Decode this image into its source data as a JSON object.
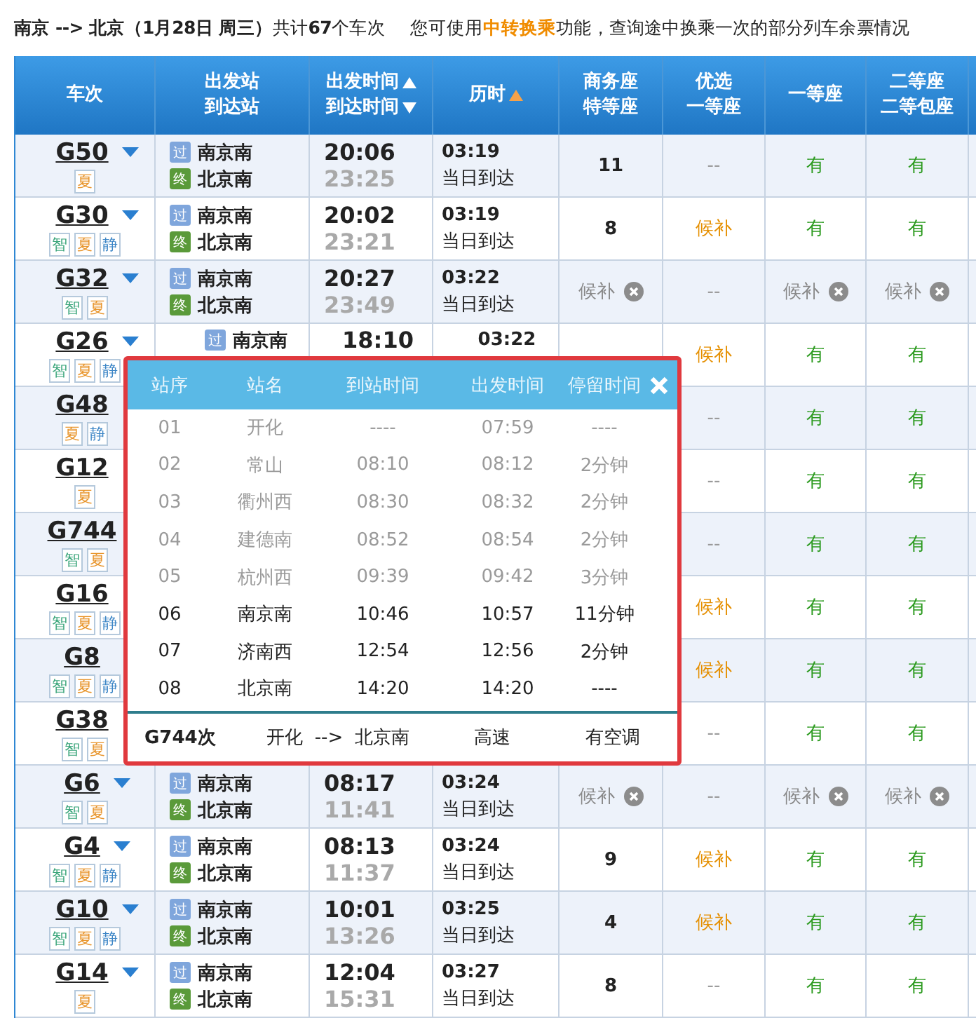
{
  "summary": "**南京 --> 北京（1月28日  周三）**共计**67**个车次",
  "notice": {
    "before": "您可使用",
    "link": "中转换乘",
    "after": "功能，查询途中换乘一次的部分列车余票情况"
  },
  "columns": [
    {
      "lines": [
        {
          "text": "车次"
        }
      ]
    },
    {
      "lines": [
        {
          "text": "出发站"
        },
        {
          "text": "到达站"
        }
      ]
    },
    {
      "lines": [
        {
          "text": "出发时间",
          "kind": "sort_up",
          "active": false
        },
        {
          "text": "到达时间",
          "kind": "sort_down",
          "active": false
        }
      ]
    },
    {
      "lines": [
        {
          "text": "历时",
          "kind": "sort_up",
          "active": true
        }
      ]
    },
    {
      "lines": [
        {
          "text": "商务座"
        },
        {
          "text": "特等座"
        }
      ]
    },
    {
      "lines": [
        {
          "text": "优选"
        },
        {
          "text": "一等座"
        }
      ]
    },
    {
      "lines": [
        {
          "text": "一等座"
        }
      ]
    },
    {
      "lines": [
        {
          "text": "二等座"
        },
        {
          "text": "二等包座"
        }
      ]
    }
  ],
  "trains": [
    {
      "code": "G50",
      "tags": [
        {
          "label": "夏",
          "color": "#e8952c"
        }
      ],
      "from": {
        "badge": "过",
        "name": "南京南"
      },
      "to": {
        "badge": "终",
        "name": "北京南"
      },
      "depart": "20:06",
      "arrive": "23:25",
      "duration": "03:19",
      "arrival_day": "当日到达",
      "business": {
        "kind": "count",
        "text": "11"
      },
      "premium_first": {
        "kind": "none",
        "text": "--"
      },
      "first": {
        "kind": "available",
        "text": "有"
      },
      "second": {
        "kind": "available",
        "text": "有"
      }
    },
    {
      "code": "G30",
      "tags": [
        {
          "label": "智",
          "color": "#3aa57a"
        },
        {
          "label": "夏",
          "color": "#e8952c"
        },
        {
          "label": "静",
          "color": "#3d86c6"
        }
      ],
      "from": {
        "badge": "过",
        "name": "南京南"
      },
      "to": {
        "badge": "终",
        "name": "北京南"
      },
      "depart": "20:02",
      "arrive": "23:21",
      "duration": "03:19",
      "arrival_day": "当日到达",
      "business": {
        "kind": "count",
        "text": "8"
      },
      "premium_first": {
        "kind": "waitlist",
        "text": "候补"
      },
      "first": {
        "kind": "available",
        "text": "有"
      },
      "second": {
        "kind": "available",
        "text": "有"
      }
    },
    {
      "code": "G32",
      "tags": [
        {
          "label": "智",
          "color": "#3aa57a"
        },
        {
          "label": "夏",
          "color": "#e8952c"
        }
      ],
      "from": {
        "badge": "过",
        "name": "南京南"
      },
      "to": {
        "badge": "终",
        "name": "北京南"
      },
      "depart": "20:27",
      "arrive": "23:49",
      "duration": "03:22",
      "arrival_day": "当日到达",
      "business": {
        "kind": "waitlist_closed",
        "text": "候补"
      },
      "premium_first": {
        "kind": "none",
        "text": "--"
      },
      "first": {
        "kind": "waitlist_closed",
        "text": "候补"
      },
      "second": {
        "kind": "waitlist_closed",
        "text": "候补"
      }
    },
    {
      "code": "G26",
      "tags": [
        {
          "label": "智",
          "color": "#3aa57a"
        },
        {
          "label": "夏",
          "color": "#e8952c"
        },
        {
          "label": "静",
          "color": "#3d86c6"
        }
      ],
      "from": {
        "badge": "过",
        "name": "南京南"
      },
      "depart": "18:10",
      "duration": "03:22",
      "premium_first": {
        "kind": "waitlist",
        "text": "候补"
      },
      "first": {
        "kind": "available",
        "text": "有"
      },
      "second": {
        "kind": "available",
        "text": "有"
      }
    },
    {
      "code": "G48",
      "tags": [
        {
          "label": "夏",
          "color": "#e8952c"
        },
        {
          "label": "静",
          "color": "#3d86c6"
        }
      ],
      "premium_first": {
        "kind": "none",
        "text": "--"
      },
      "first": {
        "kind": "available",
        "text": "有"
      },
      "second": {
        "kind": "available",
        "text": "有"
      }
    },
    {
      "code": "G12",
      "tags": [
        {
          "label": "夏",
          "color": "#e8952c"
        }
      ],
      "premium_first": {
        "kind": "none",
        "text": "--"
      },
      "first": {
        "kind": "available",
        "text": "有"
      },
      "second": {
        "kind": "available",
        "text": "有"
      }
    },
    {
      "code": "G744",
      "tags": [
        {
          "label": "智",
          "color": "#3aa57a"
        },
        {
          "label": "夏",
          "color": "#e8952c"
        }
      ],
      "premium_first": {
        "kind": "none",
        "text": "--"
      },
      "first": {
        "kind": "available",
        "text": "有"
      },
      "second": {
        "kind": "available",
        "text": "有"
      }
    },
    {
      "code": "G16",
      "tags": [
        {
          "label": "智",
          "color": "#3aa57a"
        },
        {
          "label": "夏",
          "color": "#e8952c"
        },
        {
          "label": "静",
          "color": "#3d86c6"
        }
      ],
      "premium_first": {
        "kind": "waitlist",
        "text": "候补"
      },
      "first": {
        "kind": "available",
        "text": "有"
      },
      "second": {
        "kind": "available",
        "text": "有"
      }
    },
    {
      "code": "G8",
      "tags": [
        {
          "label": "智",
          "color": "#3aa57a"
        },
        {
          "label": "夏",
          "color": "#e8952c"
        },
        {
          "label": "静",
          "color": "#3d86c6"
        }
      ],
      "premium_first": {
        "kind": "waitlist",
        "text": "候补"
      },
      "first": {
        "kind": "available",
        "text": "有"
      },
      "second": {
        "kind": "available",
        "text": "有"
      }
    },
    {
      "code": "G38",
      "tags": [
        {
          "label": "智",
          "color": "#3aa57a"
        },
        {
          "label": "夏",
          "color": "#e8952c"
        }
      ],
      "premium_first": {
        "kind": "none",
        "text": "--"
      },
      "first": {
        "kind": "available",
        "text": "有"
      },
      "second": {
        "kind": "available",
        "text": "有"
      }
    },
    {
      "code": "G6",
      "tags": [
        {
          "label": "智",
          "color": "#3aa57a"
        },
        {
          "label": "夏",
          "color": "#e8952c"
        }
      ],
      "from": {
        "badge": "过",
        "name": "南京南"
      },
      "to": {
        "badge": "终",
        "name": "北京南"
      },
      "depart": "08:17",
      "arrive": "11:41",
      "duration": "03:24",
      "arrival_day": "当日到达",
      "business": {
        "kind": "waitlist_closed",
        "text": "候补"
      },
      "premium_first": {
        "kind": "none",
        "text": "--"
      },
      "first": {
        "kind": "waitlist_closed",
        "text": "候补"
      },
      "second": {
        "kind": "waitlist_closed",
        "text": "候补"
      }
    },
    {
      "code": "G4",
      "tags": [
        {
          "label": "智",
          "color": "#3aa57a"
        },
        {
          "label": "夏",
          "color": "#e8952c"
        },
        {
          "label": "静",
          "color": "#3d86c6"
        }
      ],
      "from": {
        "badge": "过",
        "name": "南京南"
      },
      "to": {
        "badge": "终",
        "name": "北京南"
      },
      "depart": "08:13",
      "arrive": "11:37",
      "duration": "03:24",
      "arrival_day": "当日到达",
      "business": {
        "kind": "count",
        "text": "9"
      },
      "premium_first": {
        "kind": "waitlist",
        "text": "候补"
      },
      "first": {
        "kind": "available",
        "text": "有"
      },
      "second": {
        "kind": "available",
        "text": "有"
      }
    },
    {
      "code": "G10",
      "tags": [
        {
          "label": "智",
          "color": "#3aa57a"
        },
        {
          "label": "夏",
          "color": "#e8952c"
        },
        {
          "label": "静",
          "color": "#3d86c6"
        }
      ],
      "from": {
        "badge": "过",
        "name": "南京南"
      },
      "to": {
        "badge": "终",
        "name": "北京南"
      },
      "depart": "10:01",
      "arrive": "13:26",
      "duration": "03:25",
      "arrival_day": "当日到达",
      "business": {
        "kind": "count",
        "text": "4"
      },
      "premium_first": {
        "kind": "waitlist",
        "text": "候补"
      },
      "first": {
        "kind": "available",
        "text": "有"
      },
      "second": {
        "kind": "available",
        "text": "有"
      }
    },
    {
      "code": "G14",
      "tags": [
        {
          "label": "夏",
          "color": "#e8952c"
        }
      ],
      "from": {
        "badge": "过",
        "name": "南京南"
      },
      "to": {
        "badge": "终",
        "name": "北京南"
      },
      "depart": "12:04",
      "arrive": "15:31",
      "duration": "03:27",
      "arrival_day": "当日到达",
      "business": {
        "kind": "count",
        "text": "8"
      },
      "premium_first": {
        "kind": "none",
        "text": "--"
      },
      "first": {
        "kind": "available",
        "text": "有"
      },
      "second": {
        "kind": "available",
        "text": "有"
      }
    }
  ],
  "stops_popup": {
    "columns": [
      "站序",
      "站名",
      "到站时间",
      "出发时间",
      "停留时间"
    ],
    "stops": [
      {
        "no": "01",
        "station": "开化",
        "arrive": "----",
        "depart": "07:59",
        "stay": "----",
        "on_route": false
      },
      {
        "no": "02",
        "station": "常山",
        "arrive": "08:10",
        "depart": "08:12",
        "stay": "2分钟",
        "on_route": false
      },
      {
        "no": "03",
        "station": "衢州西",
        "arrive": "08:30",
        "depart": "08:32",
        "stay": "2分钟",
        "on_route": false
      },
      {
        "no": "04",
        "station": "建德南",
        "arrive": "08:52",
        "depart": "08:54",
        "stay": "2分钟",
        "on_route": false
      },
      {
        "no": "05",
        "station": "杭州西",
        "arrive": "09:39",
        "depart": "09:42",
        "stay": "3分钟",
        "on_route": false
      },
      {
        "no": "06",
        "station": "南京南",
        "arrive": "10:46",
        "depart": "10:57",
        "stay": "11分钟",
        "on_route": true
      },
      {
        "no": "07",
        "station": "济南西",
        "arrive": "12:54",
        "depart": "12:56",
        "stay": "2分钟",
        "on_route": true
      },
      {
        "no": "08",
        "station": "北京南",
        "arrive": "14:20",
        "depart": "14:20",
        "stay": "----",
        "on_route": true
      }
    ],
    "footer": {
      "train": "G744次",
      "route": "开化  -->  北京南",
      "type": "高速",
      "aircon": "有空调"
    }
  }
}
